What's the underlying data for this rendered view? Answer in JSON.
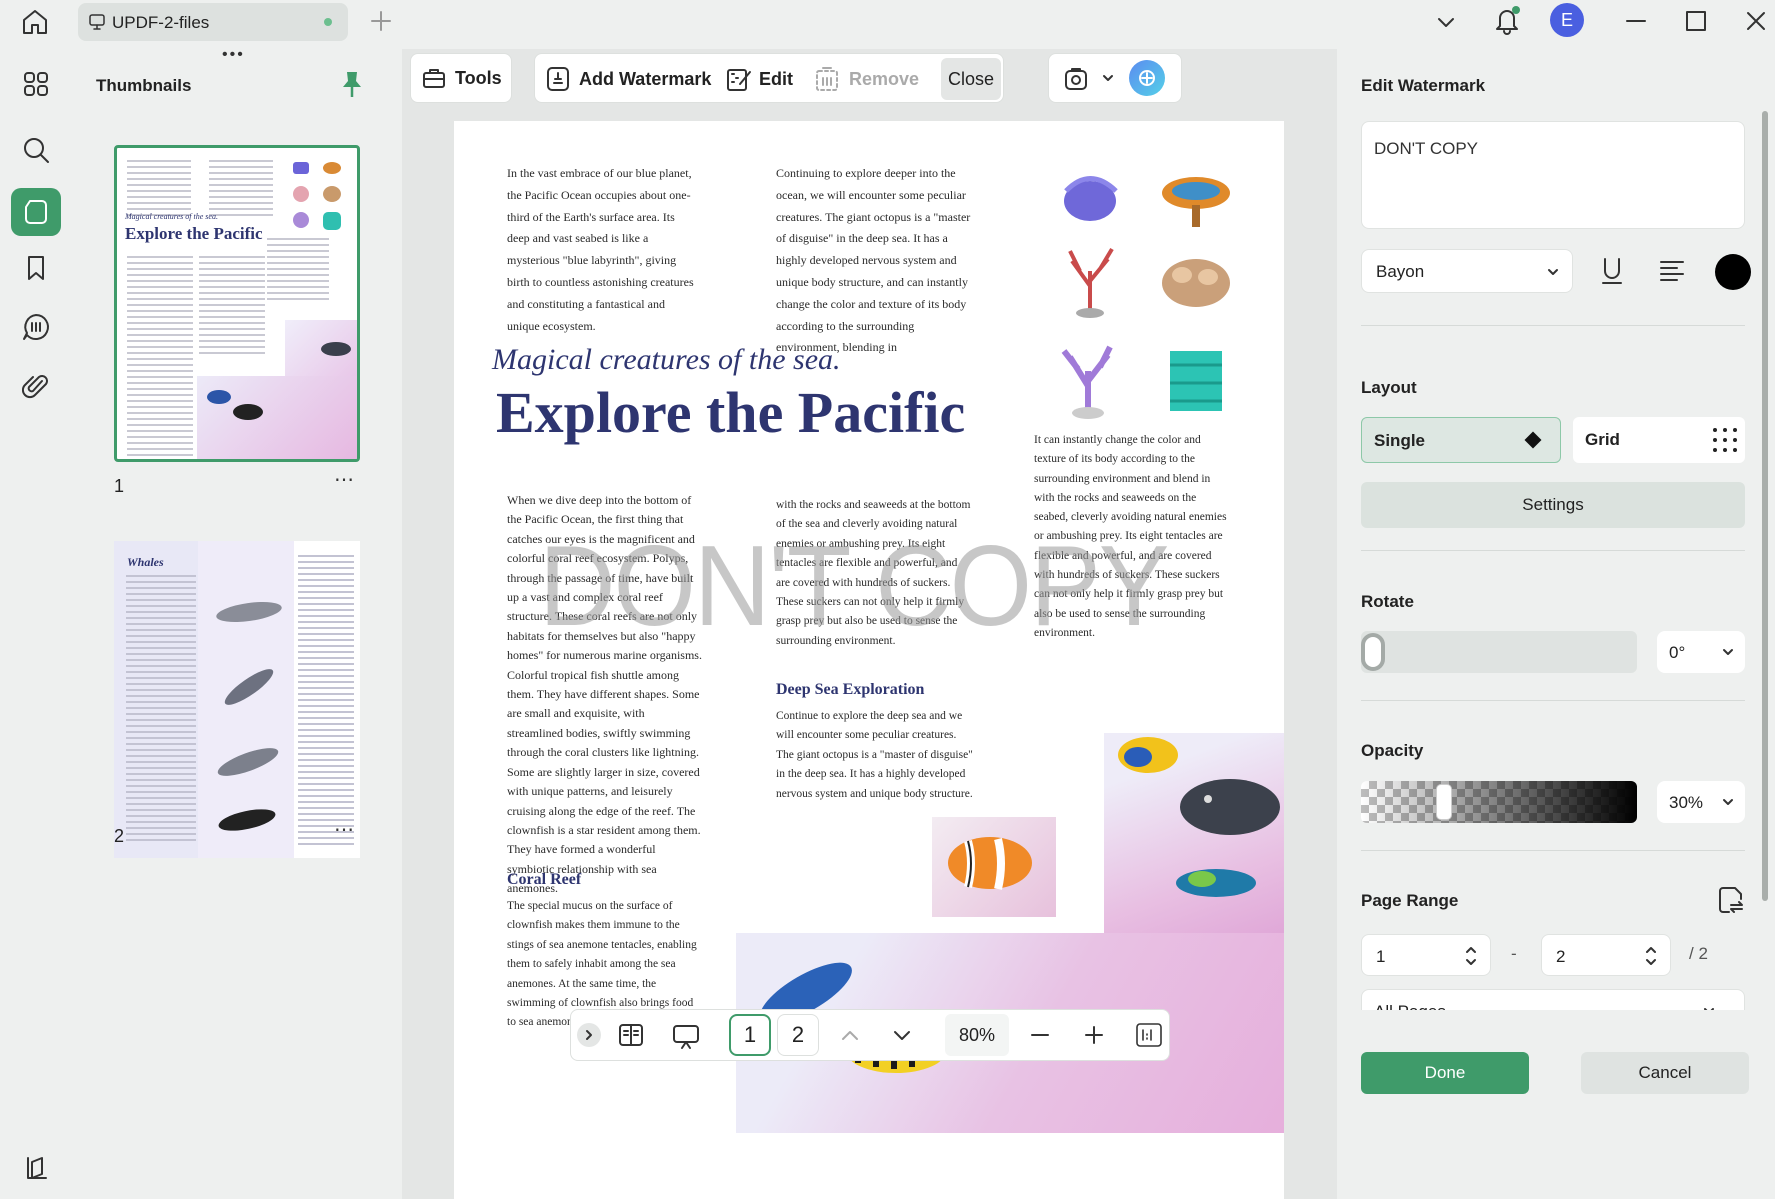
{
  "app": {
    "tab_title": "UPDF-2-files",
    "avatar_letter": "E"
  },
  "thumbnails": {
    "title": "Thumbnails",
    "pages": [
      {
        "number": "1",
        "heading": "Explore the Pacific",
        "subheading": "Magical creatures of the sea."
      },
      {
        "number": "2",
        "heading": "Whales"
      }
    ]
  },
  "toolbar": {
    "tools": "Tools",
    "add_watermark": "Add Watermark",
    "edit": "Edit",
    "remove": "Remove",
    "close": "Close"
  },
  "document": {
    "col1_intro": "In the vast embrace of our blue planet, the Pacific Ocean occupies about one-third of the Earth's surface area. Its deep and vast seabed is like a mysterious \"blue labyrinth\", giving birth to countless astonishing creatures and constituting a fantastical and unique ecosystem.",
    "col2_intro": "Continuing to explore deeper into the ocean, we will encounter some peculiar creatures. The giant octopus is a \"master of disguise\" in the deep sea. It has a highly developed nervous system and unique body structure, and can instantly change the color and texture of its body according to the surrounding environment, blending in",
    "subtitle": "Magical creatures of the sea.",
    "title": "Explore the Pacific",
    "col3_text": "It can instantly change the color and texture of its body according to the surrounding environment and blend in with the rocks and seaweeds on the seabed, cleverly avoiding natural enemies or ambushing prey. Its eight tentacles are flexible and powerful, and are covered with hundreds of suckers. These suckers can not only help it firmly grasp prey but also be used to sense the surrounding environment.",
    "col1_body": "When we dive deep into the bottom of the Pacific Ocean, the first thing that catches our eyes is the magnificent and colorful coral reef ecosystem. Polyps, through the passage of time, have built up a vast and complex coral reef structure. These coral reefs are not only habitats for themselves but also \"happy homes\" for numerous marine organisms. Colorful tropical fish shuttle among them. They have different shapes. Some are small and exquisite, with streamlined bodies, swiftly swimming through the coral clusters like lightning. Some are slightly larger in size, covered with unique patterns, and leisurely cruising along the edge of the reef. The clownfish is a star resident among them. They have formed a wonderful symbiotic relationship with sea anemones.",
    "col2_body": "with the rocks and seaweeds at the bottom of the sea and cleverly avoiding natural enemies or ambushing prey. Its eight tentacles are flexible and powerful, and are covered with hundreds of suckers. These suckers can not only help it firmly grasp prey but also be used to sense the surrounding environment.",
    "deep_sea_heading": "Deep Sea Exploration",
    "deep_sea_text": "Continue to explore the deep sea and we will encounter some peculiar creatures. The giant octopus is a \"master of disguise\" in the deep sea. It has a highly developed nervous system and unique body structure.",
    "coral_heading": "Coral Reef",
    "coral_text": "The special mucus on the surface of clownfish makes them immune to the stings of sea anemone tentacles, enabling them to safely inhabit among the sea anemones. At the same time, the swimming of clownfish also brings food to sea anemones.",
    "watermark": "DON'T COPY"
  },
  "bottom_bar": {
    "page_1": "1",
    "page_2": "2",
    "zoom": "80%"
  },
  "edit_panel": {
    "title": "Edit Watermark",
    "text_value": "DON'T COPY",
    "font": "Bayon",
    "color": "#000000",
    "layout_label": "Layout",
    "layout_single": "Single",
    "layout_grid": "Grid",
    "settings": "Settings",
    "rotate_label": "Rotate",
    "rotate_value": "0°",
    "opacity_label": "Opacity",
    "opacity_value": "30%",
    "opacity_fraction": 0.3,
    "page_range_label": "Page Range",
    "range_from": "1",
    "range_to": "2",
    "range_total": "/ 2",
    "range_mode": "All Pages",
    "done": "Done",
    "cancel": "Cancel"
  },
  "colors": {
    "accent": "#3f9b6a",
    "title_navy": "#2e3570",
    "watermark_gray": "#b3b3b3"
  }
}
